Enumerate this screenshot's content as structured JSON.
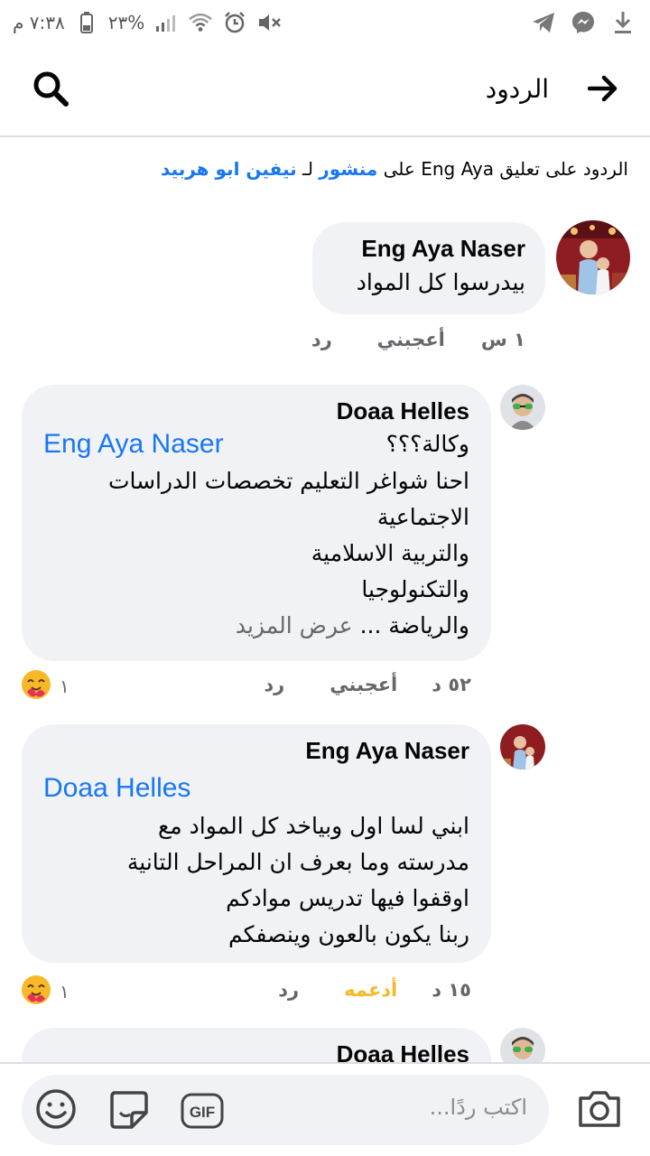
{
  "status_bar": {
    "time": "٧:٣٨ م",
    "battery": "٢٣%",
    "icons": [
      "download-icon",
      "messenger-icon",
      "telegram-icon",
      "mute-icon",
      "alarm-icon",
      "wifi-icon",
      "signal-icon",
      "battery-icon"
    ]
  },
  "header": {
    "title": "الردود",
    "back_icon": "arrow-right-icon",
    "search_icon": "search-icon"
  },
  "context": {
    "prefix": "الردود على تعليق Eng Aya على ",
    "post_link": "منشور",
    "middle": " لـ ",
    "author_link": "نيفين ابو هربيد"
  },
  "comments": [
    {
      "author": "Eng Aya Naser",
      "text_lines": [
        "بيدرسوا كل المواد"
      ],
      "time": "١ س",
      "like": "أعجبني",
      "reply": "رد"
    },
    {
      "author": "Doaa Helles",
      "mention": "Eng Aya Naser",
      "first_line": "وكالة؟؟؟",
      "text_lines": [
        "احنا شواغر التعليم تخصصات الدراسات",
        "الاجتماعية",
        "والتربية الاسلامية",
        "والتكنولوجيا"
      ],
      "last_line": "والرياضة ...",
      "see_more": "عرض المزيد",
      "time": "٥٢ د",
      "like": "أعجبني",
      "reply": "رد",
      "reaction_count": "١"
    },
    {
      "author": "Eng Aya Naser",
      "mention": "Doaa Helles",
      "text_lines": [
        "ابني لسا اول وبياخد كل المواد مع",
        "مدرسته وما بعرف ان المراحل التانية",
        "اوقفوا فيها تدريس موادكم",
        "ربنا يكون بالعون وينصفكم"
      ],
      "time": "١٥ د",
      "like": "أدعمه",
      "reply": "رد",
      "reaction_count": "١"
    },
    {
      "author": "Doaa Helles"
    }
  ],
  "composer": {
    "placeholder": "اكتب ردًا...",
    "gif_label": "GIF",
    "icons": [
      "camera-icon",
      "sticker-icon",
      "gif-icon",
      "emoji-icon"
    ]
  },
  "colors": {
    "link": "#1877f2",
    "bubble": "#f0f2f5",
    "care_reaction": "#f7b928",
    "support_text": "#f7b928",
    "muted": "#65676b"
  }
}
